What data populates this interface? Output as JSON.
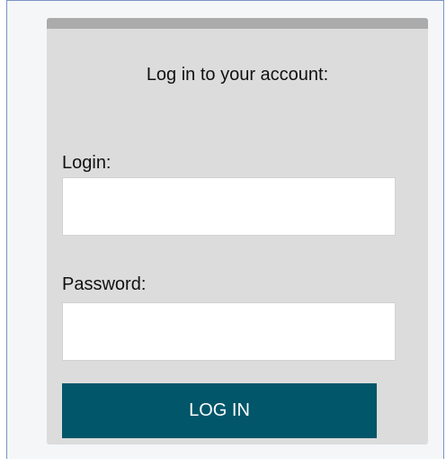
{
  "login_form": {
    "title": "Log in to your account:",
    "login_label": "Login:",
    "login_value": "",
    "password_label": "Password:",
    "password_value": "",
    "submit_label": "LOG IN"
  },
  "colors": {
    "card_background": "#dcdcdc",
    "card_topbar": "#ababab",
    "button_background": "#02566a",
    "button_text": "#ffffff",
    "page_background": "#f5f6f8",
    "frame_border": "#7b93c7"
  }
}
